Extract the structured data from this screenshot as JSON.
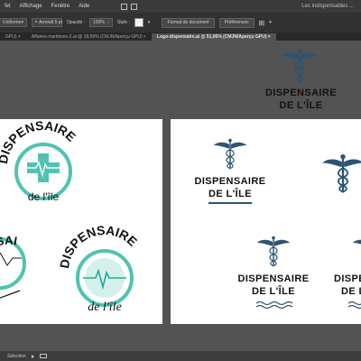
{
  "menu": [
    "fet",
    "Affichage",
    "Fenêtre",
    "Aide"
  ],
  "workspace": "Les indispensables ...",
  "control": {
    "stroke_style": "Uniforme",
    "brush": "Arrondi 5 pt",
    "opacity_label": "Opacité :",
    "opacity_value": "100%",
    "style_label": "Style :",
    "document_format": "Format de document",
    "preferences": "Préférences"
  },
  "tabs": [
    {
      "label": "GPU) ×",
      "active": false
    },
    {
      "label": "Affaires-maritimes-2.ai @ 18,56% (CMJN/Aperçu GPU) ×",
      "active": false
    },
    {
      "label": "Logo-dispensaire.ai @ 51,06% (CMJN/Aperçu GPU) ×",
      "active": true
    }
  ],
  "logo": {
    "line1": "DISPENSAIRE",
    "line2": "DE L'ÎLE",
    "line2_lower": "de l'île",
    "partial": "DISPE",
    "partial2": "DE L"
  },
  "status": {
    "tool": "Sélection"
  },
  "colors": {
    "teal": "#4fc3b0",
    "navy": "#2c5473",
    "ink": "#111111"
  }
}
